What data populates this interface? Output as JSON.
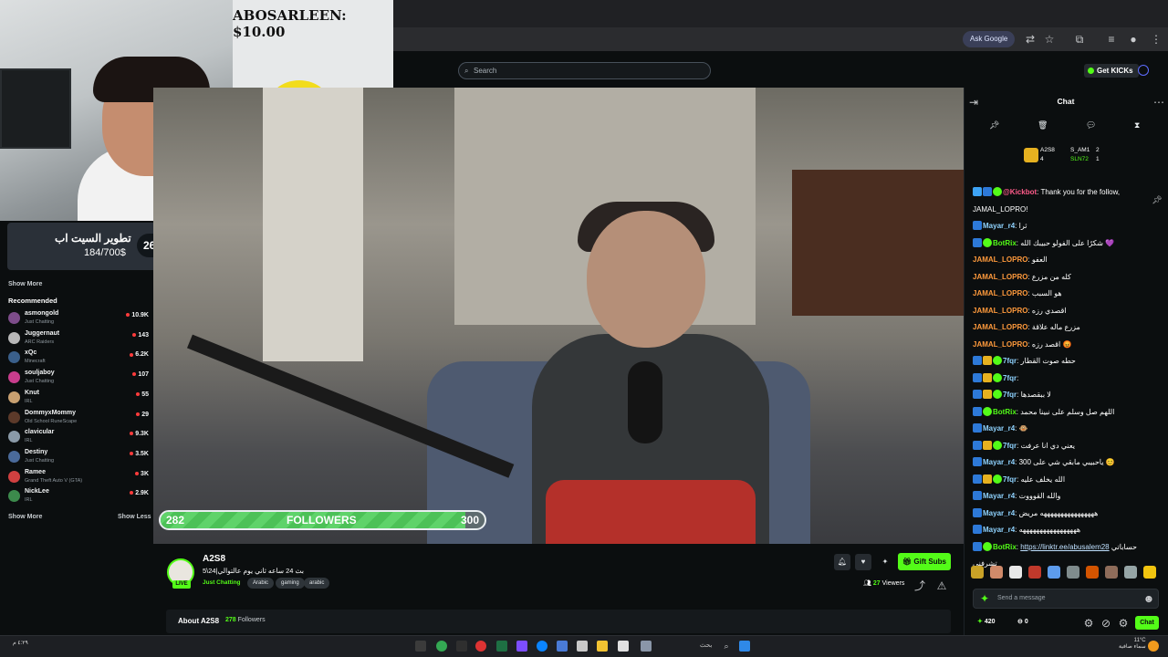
{
  "overlay": {
    "donation": "ABOSARLEEN: $10.00",
    "goal_title": "تطوير السيت اب",
    "goal_amount": "184/700$",
    "goal_percent": "26%",
    "goal_fraction": 0.26
  },
  "browser": {
    "ask_google": "Ask Google"
  },
  "header": {
    "search_placeholder": "Search",
    "get_kicks": "Get KICKs"
  },
  "sidebar": {
    "show_more_top": "Show More",
    "recommended_title": "Recommended",
    "recommended": [
      {
        "name": "asmongold",
        "category": "Just Chatting",
        "viewers": "10.9K",
        "avatar_color": "#7d4c8a"
      },
      {
        "name": "Juggernaut",
        "category": "ARC Raiders",
        "viewers": "143",
        "avatar_color": "#b8b8b8"
      },
      {
        "name": "xQc",
        "category": "Minecraft",
        "viewers": "6.2K",
        "avatar_color": "#3a5f8a"
      },
      {
        "name": "souljaboy",
        "category": "Just Chatting",
        "viewers": "107",
        "avatar_color": "#c83d8c"
      },
      {
        "name": "Knut",
        "category": "IRL",
        "viewers": "55",
        "avatar_color": "#c8a070"
      },
      {
        "name": "DommyxMommy",
        "category": "Old School RuneScape",
        "viewers": "29",
        "avatar_color": "#5c3a2a"
      },
      {
        "name": "clavicular",
        "category": "IRL",
        "viewers": "9.3K",
        "avatar_color": "#8a9aa8"
      },
      {
        "name": "Destiny",
        "category": "Just Chatting",
        "viewers": "3.5K",
        "avatar_color": "#4a6a9a"
      },
      {
        "name": "Ramee",
        "category": "Grand Theft Auto V (GTA)",
        "viewers": "3K",
        "avatar_color": "#d04040"
      },
      {
        "name": "NickLee",
        "category": "IRL",
        "viewers": "2.9K",
        "avatar_color": "#3c8a4c"
      }
    ],
    "show_more_bottom": "Show More",
    "show_less": "Show Less"
  },
  "followers_goal": {
    "current": "282",
    "label": "FOLLOWERS",
    "target": "300",
    "fraction": 0.94
  },
  "stream": {
    "live": "LIVE",
    "name": "A2S8",
    "title": "بث 24 ساعه ثاني يوم عالتوالي|24\\5",
    "category": "Just Chatting",
    "tags": [
      "Arabic",
      "gaming",
      "arabic"
    ],
    "gift_subs": "Gift Subs",
    "viewers_count": "27",
    "viewers_label": "Viewers",
    "about_title": "About A2S8",
    "about_followers_count": "278",
    "about_followers_label": "Followers"
  },
  "chat": {
    "title": "Chat",
    "top_gifters": [
      {
        "name": "A2S8",
        "count": "4"
      },
      {
        "name": "S_AM1",
        "count": "2"
      },
      {
        "name": "SLN72",
        "count": "1"
      }
    ],
    "messages": [
      {
        "user": "@Kickbot",
        "user_color": "#ff5c8a",
        "text": ": Thank you for the follow,",
        "badges": [
          "b-robot",
          "b-blue",
          "b-green"
        ]
      },
      {
        "user": "",
        "user_color": "#ffffff",
        "text": "JAMAL_LOPRO!",
        "badges": []
      },
      {
        "user": "Mayar_r4",
        "user_color": "#8fd3ff",
        "text": ": ثرا",
        "badges": [
          "b-blue"
        ]
      },
      {
        "user": "BotRix",
        "user_color": "#53fc18",
        "text": ": شكرًا على الفولو حبيبك الله 💜",
        "badges": [
          "b-blue",
          "b-green"
        ]
      },
      {
        "user": "JAMAL_LOPRO",
        "user_color": "#ff9a3c",
        "text": ": العفو",
        "badges": []
      },
      {
        "user": "JAMAL_LOPRO",
        "user_color": "#ff9a3c",
        "text": ": كله من مزرع",
        "badges": []
      },
      {
        "user": "JAMAL_LOPRO",
        "user_color": "#ff9a3c",
        "text": ": هو السبب",
        "badges": []
      },
      {
        "user": "JAMAL_LOPRO",
        "user_color": "#ff9a3c",
        "text": ": اقصدي رزه",
        "badges": []
      },
      {
        "user": "JAMAL_LOPRO",
        "user_color": "#ff9a3c",
        "text": ": مزرع ماله علاقة",
        "badges": []
      },
      {
        "user": "JAMAL_LOPRO",
        "user_color": "#ff9a3c",
        "text": ": اقصد رزه 😡",
        "badges": []
      },
      {
        "user": "7fqr",
        "user_color": "#8fd3ff",
        "text": ": حطه صوت القطار",
        "badges": [
          "b-blue",
          "b-gold",
          "b-green"
        ]
      },
      {
        "user": "7fqr",
        "user_color": "#8fd3ff",
        "text": ":",
        "badges": [
          "b-blue",
          "b-gold",
          "b-green"
        ]
      },
      {
        "user": "7fqr",
        "user_color": "#8fd3ff",
        "text": ": لا ببقصدها",
        "badges": [
          "b-blue",
          "b-gold",
          "b-green"
        ]
      },
      {
        "user": "BotRix",
        "user_color": "#53fc18",
        "text": ": اللهم صل وسلم على نبينا محمد",
        "badges": [
          "b-blue",
          "b-green"
        ]
      },
      {
        "user": "Mayar_r4",
        "user_color": "#8fd3ff",
        "text": ": 🐵",
        "badges": [
          "b-blue"
        ]
      },
      {
        "user": "7fqr",
        "user_color": "#8fd3ff",
        "text": ": يعني دي انا عرفت",
        "badges": [
          "b-blue",
          "b-gold",
          "b-green"
        ]
      },
      {
        "user": "Mayar_r4",
        "user_color": "#8fd3ff",
        "text": ": 300 ياحبيبي مابقي شي على 😊",
        "badges": [
          "b-blue"
        ]
      },
      {
        "user": "7fqr",
        "user_color": "#8fd3ff",
        "text": ": الله يخلف عليه",
        "badges": [
          "b-blue",
          "b-gold",
          "b-green"
        ]
      },
      {
        "user": "Mayar_r4",
        "user_color": "#8fd3ff",
        "text": ": والله القوووت",
        "badges": [
          "b-blue"
        ]
      },
      {
        "user": "Mayar_r4",
        "user_color": "#8fd3ff",
        "text": ": ههههههههههههههههه مريض",
        "badges": [
          "b-blue"
        ]
      },
      {
        "user": "Mayar_r4",
        "user_color": "#8fd3ff",
        "text": ": هههههههههههههههههه",
        "badges": [
          "b-blue"
        ]
      },
      {
        "user": "BotRix",
        "user_color": "#53fc18",
        "text": ": ",
        "link": "https://linktr.ee/abusalem28",
        "extra": " حساباتي",
        "badges": [
          "b-blue",
          "b-green"
        ]
      },
      {
        "user": "",
        "user_color": "#ffffff",
        "text": "تشرفني",
        "badges": []
      }
    ],
    "send_placeholder": "Send a message",
    "kicks_count": "420",
    "zero": "0",
    "send_label": "Chat"
  },
  "taskbar": {
    "search": "بحث",
    "time_right": "11°C",
    "date_right": "سماء صافية",
    "time_left": "٤:٢٩ م"
  },
  "colors": {
    "accent": "#53fc18",
    "background": "#0b0e0f"
  }
}
